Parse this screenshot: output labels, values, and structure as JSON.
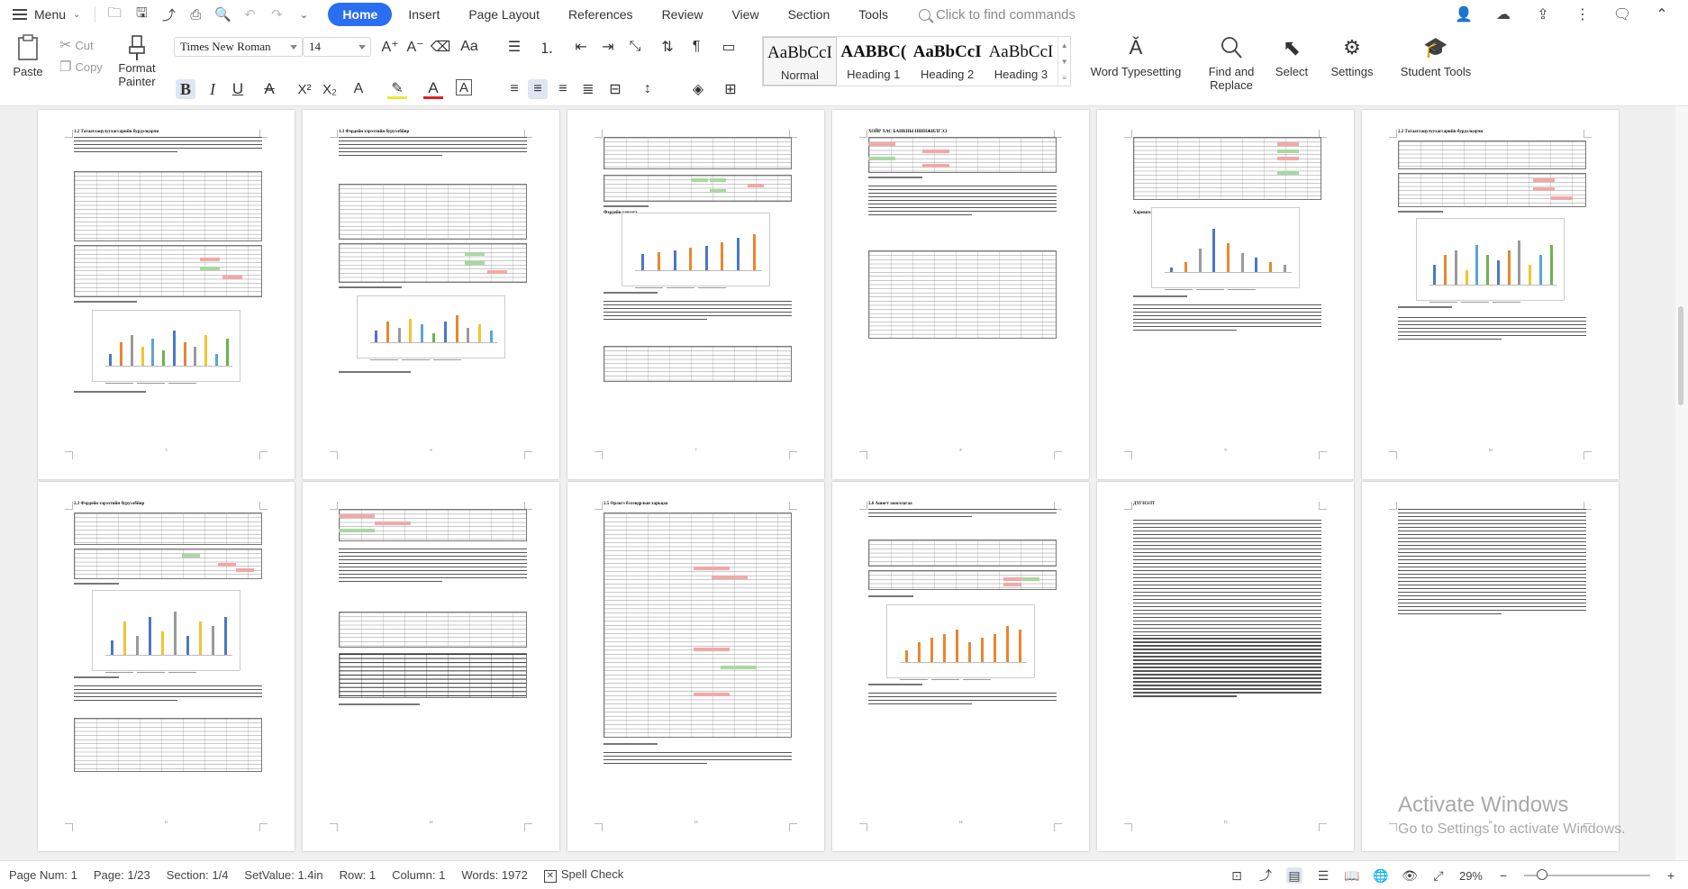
{
  "menubar": {
    "menu_label": "Menu",
    "tabs": [
      "Home",
      "Insert",
      "Page Layout",
      "References",
      "Review",
      "View",
      "Section",
      "Tools"
    ],
    "search_placeholder": "Click to find commands"
  },
  "ribbon": {
    "paste": "Paste",
    "cut": "Cut",
    "copy": "Copy",
    "format_painter_line1": "Format",
    "format_painter_line2": "Painter",
    "font_name": "Times New Roman",
    "font_size": "14",
    "styles": [
      {
        "sample": "AaBbCcI",
        "label": "Normal",
        "bold": false
      },
      {
        "sample": "AABBC(",
        "label": "Heading 1",
        "bold": true
      },
      {
        "sample": "AaBbCcI",
        "label": "Heading 2",
        "bold": true
      },
      {
        "sample": "AaBbCcI",
        "label": "Heading 3",
        "bold": false
      }
    ],
    "word_typesetting": "Word Typesetting",
    "find_replace_line1": "Find and",
    "find_replace_line2": "Replace",
    "select": "Select",
    "settings": "Settings",
    "student_tools": "Student Tools"
  },
  "pages_row1": [
    {
      "num": "5",
      "heading": "1.2  Татаатлацулуухагсарийн бурдэлцэрчи"
    },
    {
      "num": "6",
      "heading": "1.3  Фэрдейн хэрээтийн буруэлбйвр"
    },
    {
      "num": "7",
      "heading": "Фэрдейн хэрээтэ"
    },
    {
      "num": "8",
      "heading": "ХОЙР  ХАС  БАНКНЫ  ШИНЖИЛГЭЭ"
    },
    {
      "num": "9",
      "heading": "Харевич"
    },
    {
      "num": "10",
      "heading": "2.2  Татаатлацулуухагсарийн бурдэлцэрчи"
    }
  ],
  "pages_row2": [
    {
      "num": "11",
      "heading": "2.3  Фэрдейн хэрээтийн буруэлбйвр"
    },
    {
      "num": "12",
      "heading": ""
    },
    {
      "num": "13",
      "heading": "2.5  Орлогэ бэлэвдрлын харьцаа"
    },
    {
      "num": "14",
      "heading": "2.6  Ашигт ажиллагаа"
    },
    {
      "num": "15",
      "heading": "ДҮГНЭЛТ"
    },
    {
      "num": "16",
      "heading": ""
    }
  ],
  "watermark": {
    "line1": "Activate Windows",
    "line2": "Go to Settings to activate Windows."
  },
  "statusbar": {
    "page_num": "Page Num: 1",
    "page": "Page: 1/23",
    "section": "Section: 1/4",
    "setvalue": "SetValue: 1.4in",
    "row": "Row: 1",
    "column": "Column: 1",
    "words": "Words: 1972",
    "spell_check": "Spell Check",
    "zoom": "29%"
  },
  "colors": {
    "accent": "#2a6ef2",
    "chart_blue": "#4a78c5",
    "chart_orange": "#e8872e",
    "cell_red": "#f2a8a8",
    "cell_green": "#a9d8a0"
  }
}
